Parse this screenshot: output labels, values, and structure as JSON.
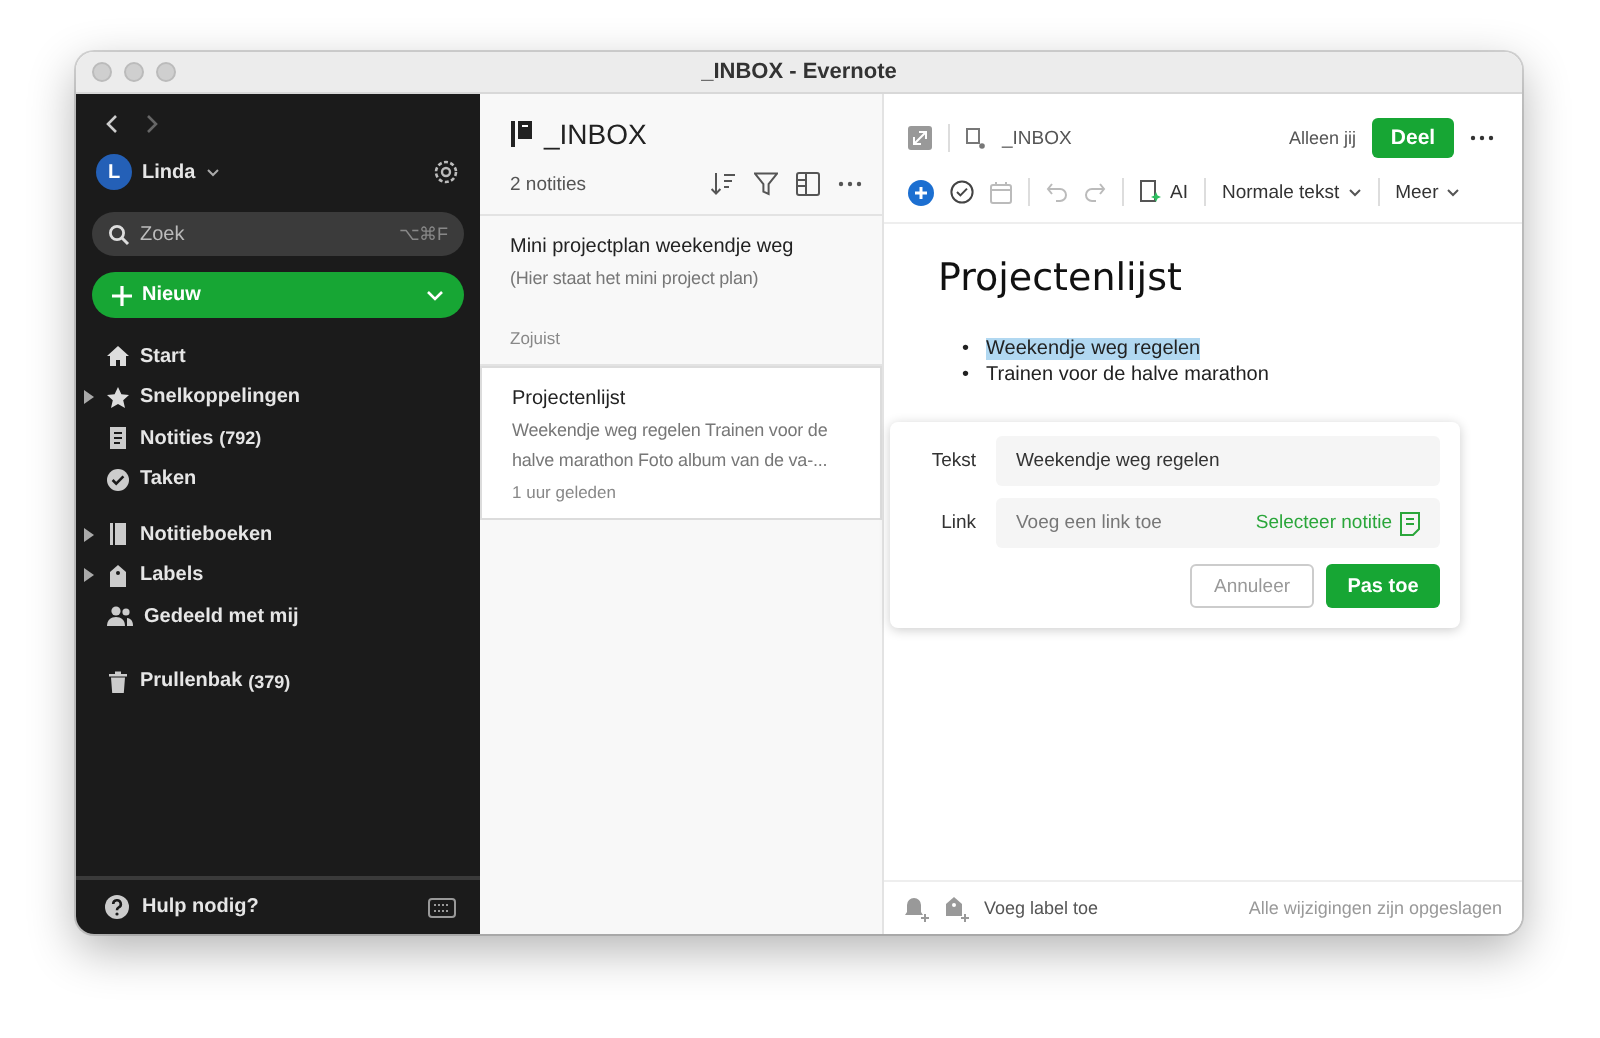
{
  "window": {
    "title": "_INBOX - Evernote"
  },
  "sidebar": {
    "user": {
      "initial": "L",
      "name": "Linda"
    },
    "search": {
      "placeholder": "Zoek",
      "shortcut": "⌥⌘F"
    },
    "new_button": {
      "label": "Nieuw"
    },
    "nav": [
      {
        "label": "Start"
      },
      {
        "label": "Snelkoppelingen",
        "expanded": false
      },
      {
        "label": "Notities",
        "count": "(792)"
      },
      {
        "label": "Taken"
      },
      {
        "label": "Notitieboeken",
        "expanded": false
      },
      {
        "label": "Labels",
        "expanded": false
      },
      {
        "label": "Gedeeld met mij"
      },
      {
        "label": "Prullenbak",
        "count": "(379)"
      }
    ],
    "help": {
      "label": "Hulp nodig?"
    }
  },
  "note_list": {
    "title": "_INBOX",
    "count": "2 notities",
    "notes": [
      {
        "title": "Mini projectplan weekendje weg",
        "snippet": "(Hier staat het mini project plan)",
        "time": "Zojuist",
        "selected": false
      },
      {
        "title": "Projectenlijst",
        "snippet": "Weekendje weg regelen Trainen voor de halve marathon Foto album van de va-...",
        "time": "1 uur geleden",
        "selected": true
      }
    ]
  },
  "editor": {
    "breadcrumb": "_INBOX",
    "share_scope": "Alleen jij",
    "share_button": "Deel",
    "toolbar": {
      "ai": "AI",
      "text_style": "Normale tekst",
      "more": "Meer"
    },
    "heading": "Projectenlijst",
    "bullets": [
      {
        "marker": "•",
        "text": "Weekendje weg regelen",
        "highlighted": true
      },
      {
        "marker": "•",
        "text": "Trainen voor de halve marathon",
        "highlighted": false
      }
    ],
    "link_popover": {
      "text_label": "Tekst",
      "text_value": "Weekendje weg regelen",
      "link_label": "Link",
      "link_placeholder": "Voeg een link toe",
      "select_note": "Selecteer notitie",
      "cancel": "Annuleer",
      "apply": "Pas toe"
    },
    "footer": {
      "add_label": "Voeg label toe",
      "status": "Alle wijzigingen zijn opgeslagen"
    }
  }
}
